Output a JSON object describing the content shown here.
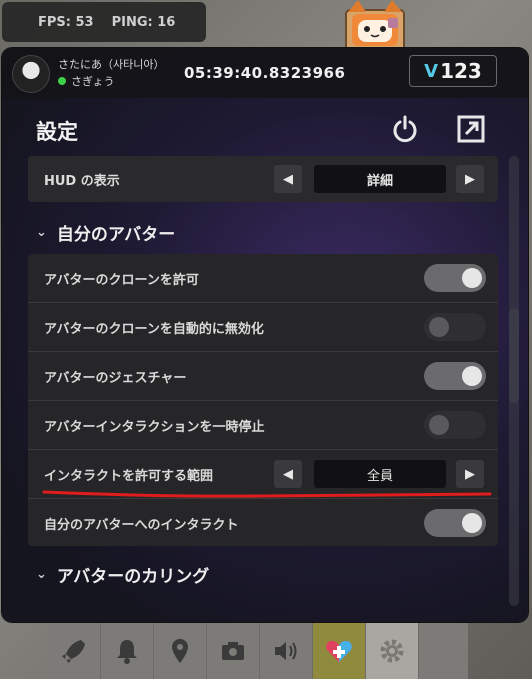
{
  "hud": {
    "fps": "FPS: 53",
    "ping": "PING: 16"
  },
  "header": {
    "username": "さたにあ（사타니아）",
    "status": "さぎょう",
    "clock": "05:39:40.8323966",
    "currency_symbol": "V",
    "currency_amount": "123"
  },
  "settings": {
    "title": "設定",
    "hud_display": {
      "label": "HUD の表示",
      "value": "詳細"
    },
    "section_my_avatar": "自分のアバター",
    "options": [
      {
        "label": "アバターのクローンを許可",
        "state": "on"
      },
      {
        "label": "アバターのクローンを自動的に無効化",
        "state": "off"
      },
      {
        "label": "アバターのジェスチャー",
        "state": "on"
      },
      {
        "label": "アバターインタラクションを一時停止",
        "state": "off"
      }
    ],
    "interaction_range": {
      "label": "インタラクトを許可する範囲",
      "value": "全員"
    },
    "self_interact": {
      "label": "自分のアバターへのインタラクト",
      "state": "on"
    },
    "section_avatar_culling": "アバターのカリング"
  },
  "colors": {
    "status_online": "#3fd04b",
    "currency_accent": "#56c9e6",
    "underline": "#e01c1c",
    "dock_active": "#8f8a3e"
  },
  "dock": [
    "rocket-icon",
    "bell-icon",
    "map-pin-icon",
    "camera-icon",
    "volume-icon",
    "heart-plus-icon",
    "gear-icon"
  ]
}
